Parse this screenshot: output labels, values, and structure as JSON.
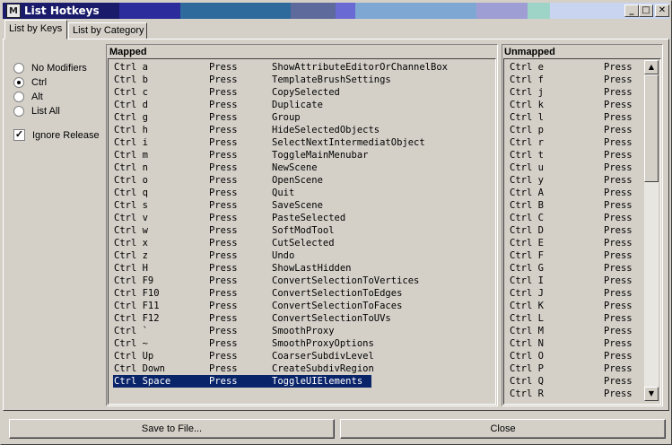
{
  "window": {
    "title": "List Hotkeys",
    "minimize_glyph": "_",
    "maximize_glyph": "□",
    "close_glyph": "✕",
    "titlebar_colors": [
      "#1b1b6b",
      "#2c2c9c",
      "#2e6a9c",
      "#5e6a9c",
      "#6a6ad4",
      "#7ea7d4",
      "#9e9ed4",
      "#9ed4c8",
      "#c8d4f0"
    ]
  },
  "tabs": [
    {
      "label": "List by Keys",
      "active": true
    },
    {
      "label": "List by Category",
      "active": false
    }
  ],
  "options": {
    "radios": [
      {
        "label": "No Modifiers",
        "checked": false
      },
      {
        "label": "Ctrl",
        "checked": true
      },
      {
        "label": "Alt",
        "checked": false
      },
      {
        "label": "List All",
        "checked": false
      }
    ],
    "ignore_release": {
      "label": "Ignore Release",
      "checked": true
    }
  },
  "mapped": {
    "header": "Mapped",
    "rows": [
      {
        "key": "Ctrl a",
        "action": "Press",
        "command": "ShowAttributeEditorOrChannelBox"
      },
      {
        "key": "Ctrl b",
        "action": "Press",
        "command": "TemplateBrushSettings"
      },
      {
        "key": "Ctrl c",
        "action": "Press",
        "command": "CopySelected"
      },
      {
        "key": "Ctrl d",
        "action": "Press",
        "command": "Duplicate"
      },
      {
        "key": "Ctrl g",
        "action": "Press",
        "command": "Group"
      },
      {
        "key": "Ctrl h",
        "action": "Press",
        "command": "HideSelectedObjects"
      },
      {
        "key": "Ctrl i",
        "action": "Press",
        "command": "SelectNextIntermediatObject"
      },
      {
        "key": "Ctrl m",
        "action": "Press",
        "command": "ToggleMainMenubar"
      },
      {
        "key": "Ctrl n",
        "action": "Press",
        "command": "NewScene"
      },
      {
        "key": "Ctrl o",
        "action": "Press",
        "command": "OpenScene"
      },
      {
        "key": "Ctrl q",
        "action": "Press",
        "command": "Quit"
      },
      {
        "key": "Ctrl s",
        "action": "Press",
        "command": "SaveScene"
      },
      {
        "key": "Ctrl v",
        "action": "Press",
        "command": "PasteSelected"
      },
      {
        "key": "Ctrl w",
        "action": "Press",
        "command": "SoftModTool"
      },
      {
        "key": "Ctrl x",
        "action": "Press",
        "command": "CutSelected"
      },
      {
        "key": "Ctrl z",
        "action": "Press",
        "command": "Undo"
      },
      {
        "key": "Ctrl H",
        "action": "Press",
        "command": "ShowLastHidden"
      },
      {
        "key": "Ctrl F9",
        "action": "Press",
        "command": "ConvertSelectionToVertices"
      },
      {
        "key": "Ctrl F10",
        "action": "Press",
        "command": "ConvertSelectionToEdges"
      },
      {
        "key": "Ctrl F11",
        "action": "Press",
        "command": "ConvertSelectionToFaces"
      },
      {
        "key": "Ctrl F12",
        "action": "Press",
        "command": "ConvertSelectionToUVs"
      },
      {
        "key": "Ctrl `",
        "action": "Press",
        "command": "SmoothProxy"
      },
      {
        "key": "Ctrl ~",
        "action": "Press",
        "command": "SmoothProxyOptions"
      },
      {
        "key": "Ctrl Up",
        "action": "Press",
        "command": "CoarserSubdivLevel"
      },
      {
        "key": "Ctrl Down",
        "action": "Press",
        "command": "CreateSubdivRegion"
      },
      {
        "key": "Ctrl Space",
        "action": "Press",
        "command": "ToggleUIElements",
        "selected": true
      }
    ]
  },
  "unmapped": {
    "header": "Unmapped",
    "rows": [
      {
        "key": "Ctrl e",
        "action": "Press"
      },
      {
        "key": "Ctrl f",
        "action": "Press"
      },
      {
        "key": "Ctrl j",
        "action": "Press"
      },
      {
        "key": "Ctrl k",
        "action": "Press"
      },
      {
        "key": "Ctrl l",
        "action": "Press"
      },
      {
        "key": "Ctrl p",
        "action": "Press"
      },
      {
        "key": "Ctrl r",
        "action": "Press"
      },
      {
        "key": "Ctrl t",
        "action": "Press"
      },
      {
        "key": "Ctrl u",
        "action": "Press"
      },
      {
        "key": "Ctrl y",
        "action": "Press"
      },
      {
        "key": "Ctrl A",
        "action": "Press"
      },
      {
        "key": "Ctrl B",
        "action": "Press"
      },
      {
        "key": "Ctrl C",
        "action": "Press"
      },
      {
        "key": "Ctrl D",
        "action": "Press"
      },
      {
        "key": "Ctrl E",
        "action": "Press"
      },
      {
        "key": "Ctrl F",
        "action": "Press"
      },
      {
        "key": "Ctrl G",
        "action": "Press"
      },
      {
        "key": "Ctrl I",
        "action": "Press"
      },
      {
        "key": "Ctrl J",
        "action": "Press"
      },
      {
        "key": "Ctrl K",
        "action": "Press"
      },
      {
        "key": "Ctrl L",
        "action": "Press"
      },
      {
        "key": "Ctrl M",
        "action": "Press"
      },
      {
        "key": "Ctrl N",
        "action": "Press"
      },
      {
        "key": "Ctrl O",
        "action": "Press"
      },
      {
        "key": "Ctrl P",
        "action": "Press"
      },
      {
        "key": "Ctrl Q",
        "action": "Press"
      },
      {
        "key": "Ctrl R",
        "action": "Press"
      }
    ],
    "scroll_position": 0.0
  },
  "buttons": {
    "save": "Save to File...",
    "close": "Close"
  }
}
